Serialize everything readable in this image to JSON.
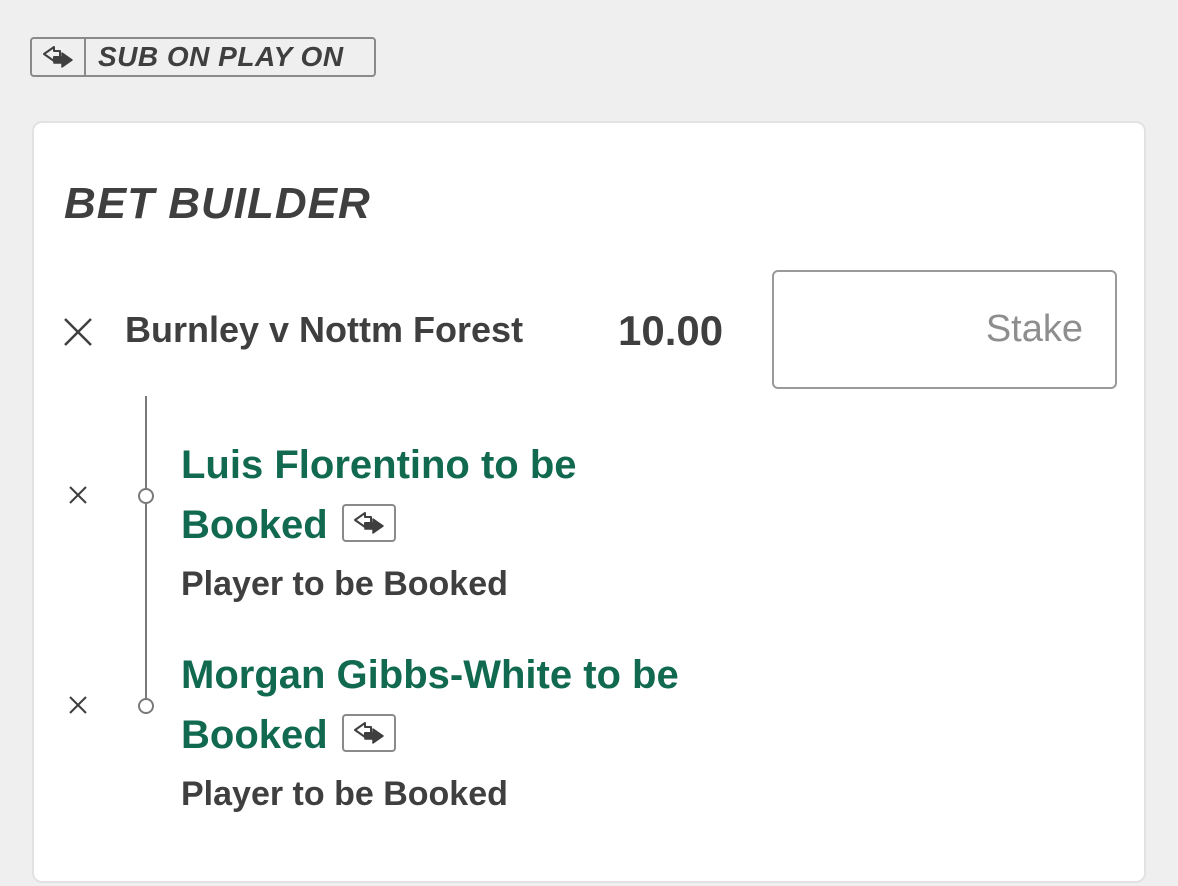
{
  "sub_badge": {
    "icon": "substitution-icon",
    "label": "SUB ON PLAY ON"
  },
  "bet_builder": {
    "title": "BET BUILDER",
    "event": {
      "name": "Burnley v Nottm Forest",
      "odds": "10.00",
      "stake_placeholder": "Stake",
      "stake_value": ""
    },
    "legs": [
      {
        "title_line1": "Luis Florentino to be",
        "title_line2": "Booked",
        "market": "Player to be Booked"
      },
      {
        "title_line1": "Morgan Gibbs-White to be",
        "title_line2": "Booked",
        "market": "Player to be Booked"
      }
    ]
  },
  "colors": {
    "background": "#efefef",
    "card": "#ffffff",
    "text": "#3f3f3f",
    "selection_green": "#116a4f",
    "border": "#8a8a8a"
  }
}
